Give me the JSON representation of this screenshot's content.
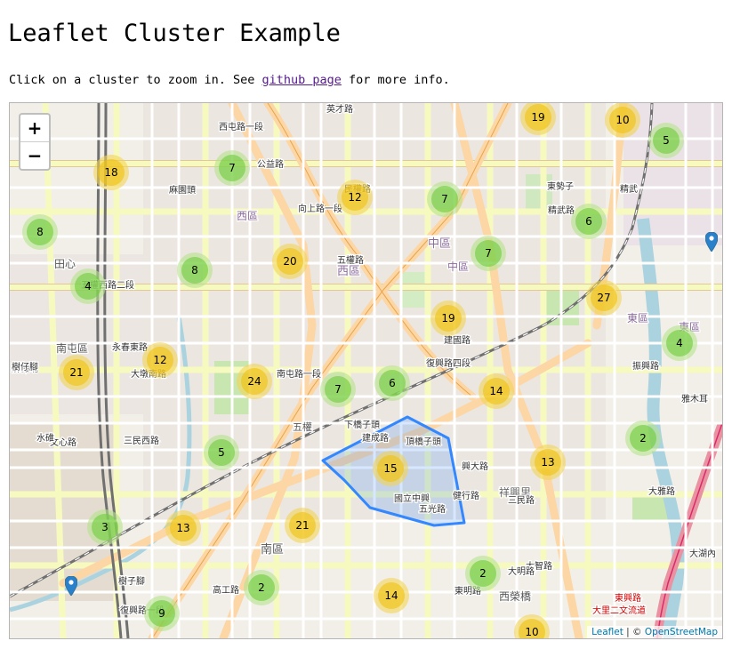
{
  "page": {
    "title": "Leaflet Cluster Example",
    "intro_before": "Click on a cluster to zoom in. See ",
    "intro_link": "github page",
    "intro_after": " for more info."
  },
  "map": {
    "zoom_in": "+",
    "zoom_out": "−",
    "attribution": {
      "leaflet": "Leaflet",
      "separator": " | © ",
      "osm": "OpenStreetMap"
    },
    "colors": {
      "cluster_small": "#6ecc39",
      "cluster_medium": "#f0c20c",
      "polygon": "#3388ff",
      "marker": "#2a81cb"
    },
    "clusters": [
      {
        "count": "19",
        "tier": "medium"
      },
      {
        "count": "10",
        "tier": "medium"
      },
      {
        "count": "5",
        "tier": "small"
      },
      {
        "count": "18",
        "tier": "medium"
      },
      {
        "count": "7",
        "tier": "small"
      },
      {
        "count": "12",
        "tier": "medium"
      },
      {
        "count": "7",
        "tier": "small"
      },
      {
        "count": "6",
        "tier": "small"
      },
      {
        "count": "8",
        "tier": "small"
      },
      {
        "count": "7",
        "tier": "small"
      },
      {
        "count": "20",
        "tier": "medium"
      },
      {
        "count": "8",
        "tier": "small"
      },
      {
        "count": "4",
        "tier": "small"
      },
      {
        "count": "27",
        "tier": "medium"
      },
      {
        "count": "19",
        "tier": "medium"
      },
      {
        "count": "4",
        "tier": "small"
      },
      {
        "count": "12",
        "tier": "medium"
      },
      {
        "count": "21",
        "tier": "medium"
      },
      {
        "count": "24",
        "tier": "medium"
      },
      {
        "count": "7",
        "tier": "small"
      },
      {
        "count": "6",
        "tier": "small"
      },
      {
        "count": "14",
        "tier": "medium"
      },
      {
        "count": "2",
        "tier": "small"
      },
      {
        "count": "5",
        "tier": "small"
      },
      {
        "count": "15",
        "tier": "medium"
      },
      {
        "count": "13",
        "tier": "medium"
      },
      {
        "count": "3",
        "tier": "small"
      },
      {
        "count": "13",
        "tier": "medium"
      },
      {
        "count": "21",
        "tier": "medium"
      },
      {
        "count": "2",
        "tier": "small"
      },
      {
        "count": "2",
        "tier": "small"
      },
      {
        "count": "14",
        "tier": "medium"
      },
      {
        "count": "9",
        "tier": "small"
      },
      {
        "count": "10",
        "tier": "medium"
      }
    ],
    "labels": [
      "西區",
      "中區",
      "西區",
      "中區",
      "東區",
      "東區",
      "南屯區",
      "南區",
      "田心",
      "五權",
      "西屯路一段",
      "英才路",
      "五權路",
      "民權路",
      "公益路",
      "向上路一段",
      "五權西路二段",
      "復興路四段",
      "建國路",
      "三民西路",
      "南屯路一段",
      "永春東路",
      "大墩南路",
      "麻園頭",
      "建成路",
      "頂橋子頭",
      "國立中興",
      "興大路",
      "祥興里",
      "下橋子頭",
      "振興路",
      "雅木耳",
      "大里",
      "東興路",
      "西榮橋",
      "樹子腳",
      "高工路",
      "五光路",
      "復興路一段",
      "文心路",
      "精武",
      "東勢子",
      "精武路",
      "大雅路",
      "大湖內",
      "水碓",
      "麻糍埔",
      "樹仔腳",
      "健行路",
      "三民路",
      "大里二文流道",
      "大智路",
      "大明路",
      "東明路"
    ]
  }
}
